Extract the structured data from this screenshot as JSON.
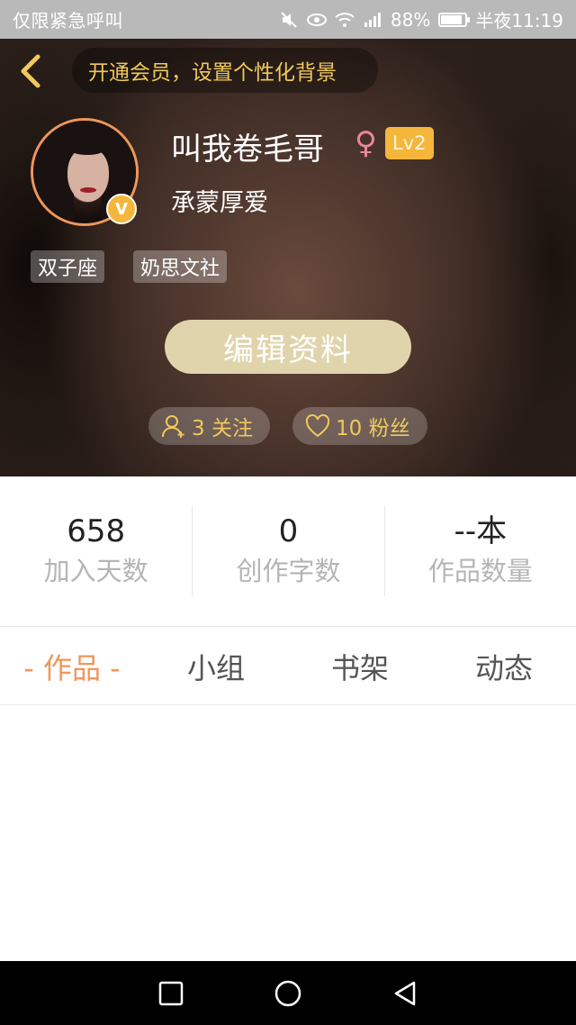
{
  "status_bar": {
    "carrier": "仅限紧急呼叫",
    "battery_percent": "88%",
    "battery_level": 0.88,
    "time": "半夜11:19"
  },
  "header": {
    "vip_banner": "开通会员，设置个性化背景",
    "username": "叫我卷毛哥",
    "gender_symbol": "♀",
    "level": "Lv2",
    "verified_badge": "V",
    "subtitle": "承蒙厚爱",
    "tags": [
      "双子座",
      "奶思文社"
    ],
    "edit_button": "编辑资料",
    "following": "3 关注",
    "fans": "10 粉丝"
  },
  "stats": [
    {
      "value": "658",
      "label": "加入天数"
    },
    {
      "value": "0",
      "label": "创作字数"
    },
    {
      "value": "--本",
      "label": "作品数量"
    }
  ],
  "tabs": [
    {
      "label": "- 作品 -",
      "active": true
    },
    {
      "label": "小组",
      "active": false
    },
    {
      "label": "书架",
      "active": false
    },
    {
      "label": "动态",
      "active": false
    }
  ],
  "colors": {
    "accent_orange": "#f0965a",
    "gold": "#f0c95a",
    "edit_button_bg": "#e0d4ac",
    "level_badge": "#f5b63c"
  },
  "icons": {
    "back": "chevron-left-icon",
    "follow": "user-icon",
    "fans": "heart-icon",
    "nav_recent": "square-icon",
    "nav_home": "circle-icon",
    "nav_back": "triangle-left-icon"
  }
}
